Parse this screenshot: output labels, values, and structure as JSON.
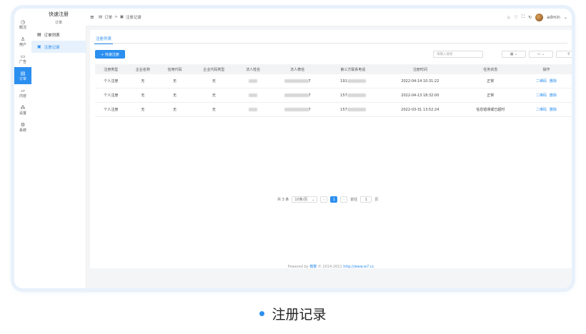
{
  "sidebar": {
    "items": [
      {
        "icon": "clock-icon",
        "glyph": "◷",
        "label": "概况"
      },
      {
        "icon": "user-icon",
        "glyph": "♙",
        "label": "用户"
      },
      {
        "icon": "ad-icon",
        "glyph": "▭",
        "label": "广告"
      },
      {
        "icon": "order-icon",
        "glyph": "▤",
        "label": "订单",
        "active": true
      },
      {
        "icon": "folder-icon",
        "glyph": "▱",
        "label": "内容"
      },
      {
        "icon": "settings-tree-icon",
        "glyph": "⁂",
        "label": "设置"
      },
      {
        "icon": "gear-icon",
        "glyph": "⚙",
        "label": "系统"
      }
    ]
  },
  "submenu": {
    "title": "快速注册",
    "subtitle": "订单",
    "items": [
      {
        "label": "订单列表",
        "glyph": "▤"
      },
      {
        "label": "注册记录",
        "glyph": "▣",
        "active": true
      }
    ]
  },
  "topbar": {
    "breadcrumb": [
      "订单",
      ">",
      "注册记录"
    ],
    "username": "admin"
  },
  "content": {
    "tab_label": "注册列表",
    "add_button_label": "+ 快速注册",
    "search_placeholder": "请输入搜索",
    "table": {
      "headers": [
        "注册类型",
        "企业名称",
        "信用代码",
        "企业代码类型",
        "法人姓名",
        "法人微信",
        "第三方联系电话",
        "注册时间",
        "任务状态",
        "操作"
      ],
      "rows": [
        {
          "type": "个人注册",
          "company": "无",
          "credit": "无",
          "code_type": "无",
          "wechat_tail": "7",
          "phone_prefix": "191",
          "time": "2022-04-14 10:31:22",
          "status": "正常"
        },
        {
          "type": "个人注册",
          "company": "无",
          "credit": "无",
          "code_type": "无",
          "wechat_tail": "7",
          "phone_prefix": "157",
          "time": "2022-04-13 18:32:00",
          "status": "正常"
        },
        {
          "type": "个人注册",
          "company": "无",
          "credit": "无",
          "code_type": "无",
          "wechat_tail": "7",
          "phone_prefix": "157",
          "time": "2022-03-31 13:52:24",
          "status": "信息错误或已超时"
        }
      ],
      "actions": [
        "二维码",
        "删除"
      ]
    },
    "pagination": {
      "total": "共 3 条",
      "page_size": "10条/页",
      "current": "1",
      "goto_label": "前往",
      "goto_value": "1",
      "page_unit": "页"
    }
  },
  "footer": {
    "prefix": "Powered by ",
    "brand": "微擎",
    "middle": " © 2014-2021 ",
    "link": "http://www.w7.cc"
  },
  "caption": "注册记录",
  "colors": {
    "accent": "#2b8ff0"
  }
}
